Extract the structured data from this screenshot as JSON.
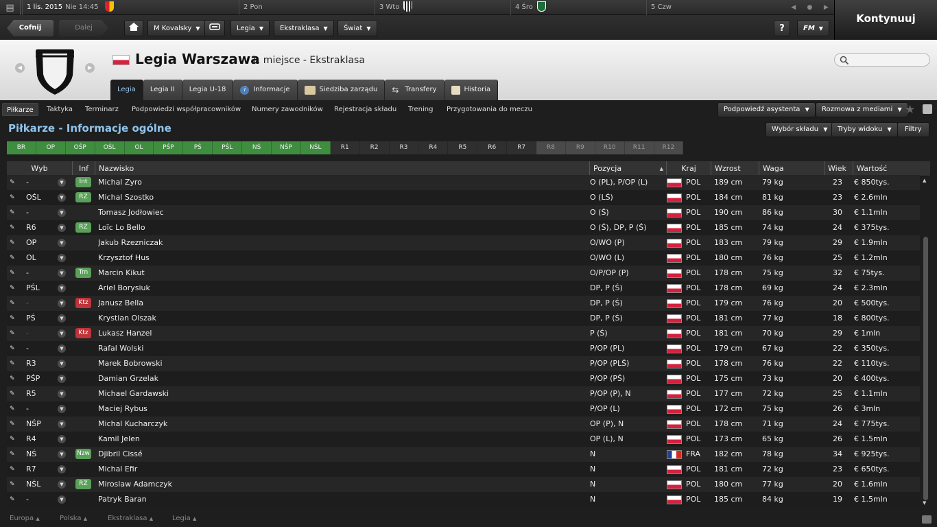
{
  "topbar": {
    "current_date": "1 lis. 2015",
    "current_day": "Nie 14:45",
    "days": [
      "2 Pon",
      "3 Wto",
      "4 Śro",
      "5 Czw"
    ],
    "continue_label": "Kontynuuj"
  },
  "toolbar": {
    "back_label": "Cofnij",
    "forward_label": "Dalej",
    "manager_label": "M Kovalsky",
    "club_label": "Legia",
    "league_label": "Ekstraklasa",
    "world_label": "Świat",
    "help_label": "?",
    "fm_label": "FM"
  },
  "header": {
    "club_name": "Legia Warszawa",
    "club_subtitle": "1. miejsce - Ekstraklasa",
    "tabs": [
      "Legia",
      "Legia II",
      "Legia U-18",
      "Informacje",
      "Siedziba zarządu",
      "Transfery",
      "Historia"
    ],
    "search_placeholder": ""
  },
  "subnav": {
    "items": [
      "Piłkarze",
      "Taktyka",
      "Terminarz",
      "Podpowiedzi współpracowników",
      "Numery zawodników",
      "Rejestracja składu",
      "Trening",
      "Przygotowania do meczu"
    ],
    "assistant_label": "Podpowiedź asystenta",
    "media_label": "Rozmowa z mediami"
  },
  "page": {
    "title": "Piłkarze - Informacje ogólne",
    "squad_select_label": "Wybór składu",
    "view_mode_label": "Tryby widoku",
    "filters_label": "Filtry"
  },
  "positions": {
    "first_team": [
      "BR",
      "OP",
      "OŚP",
      "OŚL",
      "OL",
      "PŚP",
      "PŚ",
      "PŚL",
      "NŚ",
      "NŚP",
      "NŚL"
    ],
    "reserves": [
      "R1",
      "R2",
      "R3",
      "R4",
      "R5",
      "R6",
      "R7"
    ],
    "reserves_empty": [
      "R8",
      "R9",
      "R10",
      "R11",
      "R12"
    ]
  },
  "table": {
    "headers": {
      "sel": "Wyb",
      "inf": "Inf",
      "name": "Nazwisko",
      "pos": "Pozycja",
      "nat": "Kraj",
      "height": "Wzrost",
      "weight": "Waga",
      "age": "Wiek",
      "value": "Wartość"
    },
    "rows": [
      {
        "sel": "-",
        "inf": "Int",
        "inf_color": "#5aa05a",
        "name": "Michal Zyro",
        "pos": "O (PL), P/OP (L)",
        "nat": "POL",
        "height": "189 cm",
        "weight": "79 kg",
        "age": "23",
        "value": "€ 850tys."
      },
      {
        "sel": "OŚL",
        "inf": "RZ",
        "inf_color": "#5aa05a",
        "name": "Michal Szostko",
        "pos": "O (LŚ)",
        "nat": "POL",
        "height": "184 cm",
        "weight": "81 kg",
        "age": "23",
        "value": "€ 2.6mln"
      },
      {
        "sel": "-",
        "inf": "",
        "inf_color": "",
        "name": "Tomasz Jodłowiec",
        "pos": "O (Ś)",
        "nat": "POL",
        "height": "190 cm",
        "weight": "86 kg",
        "age": "30",
        "value": "€ 1.1mln"
      },
      {
        "sel": "R6",
        "inf": "RZ",
        "inf_color": "#5aa05a",
        "name": "Loïc Lo Bello",
        "pos": "O (Ś), DP, P (Ś)",
        "nat": "POL",
        "height": "185 cm",
        "weight": "74 kg",
        "age": "24",
        "value": "€ 375tys."
      },
      {
        "sel": "OP",
        "inf": "",
        "inf_color": "",
        "name": "Jakub Rzezniczak",
        "pos": "O/WO (P)",
        "nat": "POL",
        "height": "183 cm",
        "weight": "79 kg",
        "age": "29",
        "value": "€ 1.9mln"
      },
      {
        "sel": "OL",
        "inf": "",
        "inf_color": "",
        "name": "Krzysztof Hus",
        "pos": "O/WO (L)",
        "nat": "POL",
        "height": "180 cm",
        "weight": "76 kg",
        "age": "25",
        "value": "€ 1.2mln"
      },
      {
        "sel": "-",
        "inf": "Trn",
        "inf_color": "#5aa05a",
        "name": "Marcin Kikut",
        "pos": "O/P/OP (P)",
        "nat": "POL",
        "height": "178 cm",
        "weight": "75 kg",
        "age": "32",
        "value": "€ 75tys."
      },
      {
        "sel": "PŚL",
        "inf": "",
        "inf_color": "",
        "name": "Ariel Borysiuk",
        "pos": "DP, P (Ś)",
        "nat": "POL",
        "height": "178 cm",
        "weight": "69 kg",
        "age": "24",
        "value": "€ 2.3mln"
      },
      {
        "sel": "-",
        "inf": "Ktz",
        "inf_color": "#c0343a",
        "name": "Janusz Bella",
        "pos": "DP, P (Ś)",
        "nat": "POL",
        "height": "179 cm",
        "weight": "76 kg",
        "age": "20",
        "value": "€ 500tys."
      },
      {
        "sel": "PŚ",
        "inf": "",
        "inf_color": "",
        "name": "Krystian Olszak",
        "pos": "DP, P (Ś)",
        "nat": "POL",
        "height": "181 cm",
        "weight": "77 kg",
        "age": "18",
        "value": "€ 800tys."
      },
      {
        "sel": "-",
        "inf": "Ktz",
        "inf_color": "#c0343a",
        "name": "Lukasz Hanzel",
        "pos": "P (Ś)",
        "nat": "POL",
        "height": "181 cm",
        "weight": "70 kg",
        "age": "29",
        "value": "€ 1mln"
      },
      {
        "sel": "-",
        "inf": "",
        "inf_color": "",
        "name": "Rafal Wolski",
        "pos": "P/OP (PL)",
        "nat": "POL",
        "height": "179 cm",
        "weight": "67 kg",
        "age": "22",
        "value": "€ 350tys."
      },
      {
        "sel": "R3",
        "inf": "",
        "inf_color": "",
        "name": "Marek Bobrowski",
        "pos": "P/OP (PLŚ)",
        "nat": "POL",
        "height": "178 cm",
        "weight": "76 kg",
        "age": "22",
        "value": "€ 110tys."
      },
      {
        "sel": "PŚP",
        "inf": "",
        "inf_color": "",
        "name": "Damian Grzelak",
        "pos": "P/OP (PŚ)",
        "nat": "POL",
        "height": "175 cm",
        "weight": "73 kg",
        "age": "20",
        "value": "€ 400tys."
      },
      {
        "sel": "R5",
        "inf": "",
        "inf_color": "",
        "name": "Michael Gardawski",
        "pos": "P/OP (P), N",
        "nat": "POL",
        "height": "177 cm",
        "weight": "72 kg",
        "age": "25",
        "value": "€ 1.1mln"
      },
      {
        "sel": "-",
        "inf": "",
        "inf_color": "",
        "name": "Maciej Rybus",
        "pos": "P/OP (L)",
        "nat": "POL",
        "height": "172 cm",
        "weight": "75 kg",
        "age": "26",
        "value": "€ 3mln"
      },
      {
        "sel": "NŚP",
        "inf": "",
        "inf_color": "",
        "name": "Michal Kucharczyk",
        "pos": "OP (P), N",
        "nat": "POL",
        "height": "178 cm",
        "weight": "71 kg",
        "age": "24",
        "value": "€ 775tys."
      },
      {
        "sel": "R4",
        "inf": "",
        "inf_color": "",
        "name": "Kamil Jelen",
        "pos": "OP (L), N",
        "nat": "POL",
        "height": "173 cm",
        "weight": "65 kg",
        "age": "26",
        "value": "€ 1.5mln"
      },
      {
        "sel": "NŚ",
        "inf": "Nzw",
        "inf_color": "#5aa05a",
        "name": "Djibril Cissé",
        "pos": "N",
        "nat": "FRA",
        "height": "182 cm",
        "weight": "78 kg",
        "age": "34",
        "value": "€ 925tys."
      },
      {
        "sel": "R7",
        "inf": "",
        "inf_color": "",
        "name": "Michal Efir",
        "pos": "N",
        "nat": "POL",
        "height": "181 cm",
        "weight": "72 kg",
        "age": "23",
        "value": "€ 650tys."
      },
      {
        "sel": "NŚL",
        "inf": "RZ",
        "inf_color": "#5aa05a",
        "name": "Miroslaw Adamczyk",
        "pos": "N",
        "nat": "POL",
        "height": "180 cm",
        "weight": "77 kg",
        "age": "20",
        "value": "€ 1.6mln"
      },
      {
        "sel": "-",
        "inf": "",
        "inf_color": "",
        "name": "Patryk Baran",
        "pos": "N",
        "nat": "POL",
        "height": "185 cm",
        "weight": "84 kg",
        "age": "19",
        "value": "€ 1.5mln"
      }
    ]
  },
  "footer": {
    "crumbs": [
      "Europa",
      "Polska",
      "Ekstraklasa",
      "Legia"
    ]
  },
  "colors": {
    "accent_blue": "#8fc4ec",
    "position_green": "#3f8e3f",
    "badge_green": "#5aa05a",
    "badge_red": "#c0343a"
  }
}
